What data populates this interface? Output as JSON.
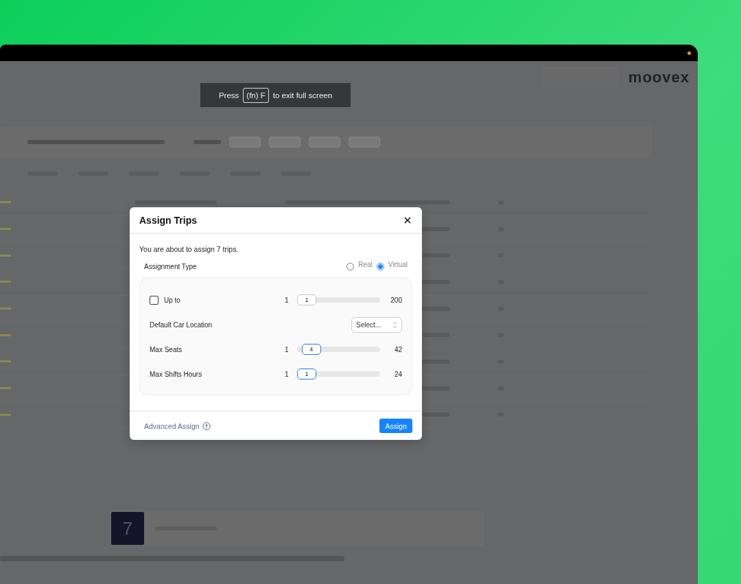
{
  "toast": {
    "before": "Press",
    "key": "(fn) F",
    "after": "to exit full screen"
  },
  "logo": "moovex",
  "selection_badge": "7",
  "dialog": {
    "title": "Assign Trips",
    "message": "You are about to assign 7 trips.",
    "assignment_type": {
      "label": "Assignment Type",
      "options": [
        {
          "label": "Real",
          "selected": false
        },
        {
          "label": "Virtual",
          "selected": true
        }
      ]
    },
    "settings": [
      {
        "kind": "slider",
        "label": "Up to",
        "checked": false,
        "disabled": true,
        "min": "1",
        "max": "200",
        "value": "1",
        "level": 0
      },
      {
        "kind": "select",
        "label": "Default Car Location",
        "placeholder": "Select..."
      },
      {
        "kind": "slider",
        "label": "Max Seats",
        "disabled": false,
        "min": "1",
        "max": "42",
        "value": "4",
        "level": 0.073
      },
      {
        "kind": "slider",
        "label": "Max Shifts Hours",
        "disabled": false,
        "min": "1",
        "max": "24",
        "value": "1",
        "level": 0
      }
    ],
    "advanced_link": "Advanced Assign",
    "assign_button": "Assign"
  }
}
